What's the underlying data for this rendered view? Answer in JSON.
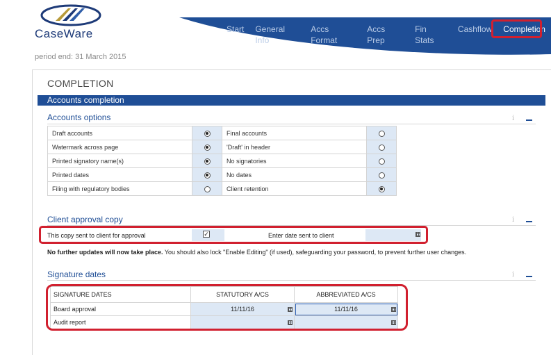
{
  "header": {
    "logo_text": "CaseWare",
    "period": "period end: 31 March 2015",
    "nav": [
      "Start",
      "General Info",
      "Accs Format",
      "Accs Prep",
      "Fin Stats",
      "Cashflow",
      "Completion"
    ],
    "active_nav": "Completion"
  },
  "page_title": "COMPLETION",
  "band_title": "Accounts completion",
  "accounts_options": {
    "title": "Accounts options",
    "info": "i",
    "rows": [
      {
        "left": "Draft accounts",
        "left_on": true,
        "right": "Final accounts",
        "right_on": false
      },
      {
        "left": "Watermark across page",
        "left_on": true,
        "right": "'Draft' in header",
        "right_on": false
      },
      {
        "left": "Printed signatory name(s)",
        "left_on": true,
        "right": "No signatories",
        "right_on": false
      },
      {
        "left": "Printed dates",
        "left_on": true,
        "right": "No dates",
        "right_on": false
      },
      {
        "left": "Filing with regulatory bodies",
        "left_on": false,
        "right": "Client retention",
        "right_on": true
      }
    ]
  },
  "client_approval": {
    "title": "Client approval copy",
    "info": "i",
    "label": "This copy sent to client for approval",
    "checked": true,
    "check_mark": "✓",
    "date_label": "Enter date sent to client",
    "date_value": "",
    "notice_bold": "No further updates will now take place.",
    "notice_rest": "  You should also lock \"Enable Editing\" (if used), safeguarding your password, to prevent further user changes."
  },
  "signature_dates": {
    "title": "Signature dates",
    "info": "i",
    "headers": [
      "SIGNATURE DATES",
      "STATUTORY A/CS",
      "ABBREVIATED A/CS"
    ],
    "rows": [
      {
        "label": "Board approval",
        "statutory": "11/11/16",
        "abbreviated": "11/11/16"
      },
      {
        "label": "Audit report",
        "statutory": "",
        "abbreviated": ""
      }
    ]
  },
  "colors": {
    "brand_blue": "#1f4e96",
    "highlight_red": "#d1202f",
    "input_fill": "#dde8f5"
  }
}
